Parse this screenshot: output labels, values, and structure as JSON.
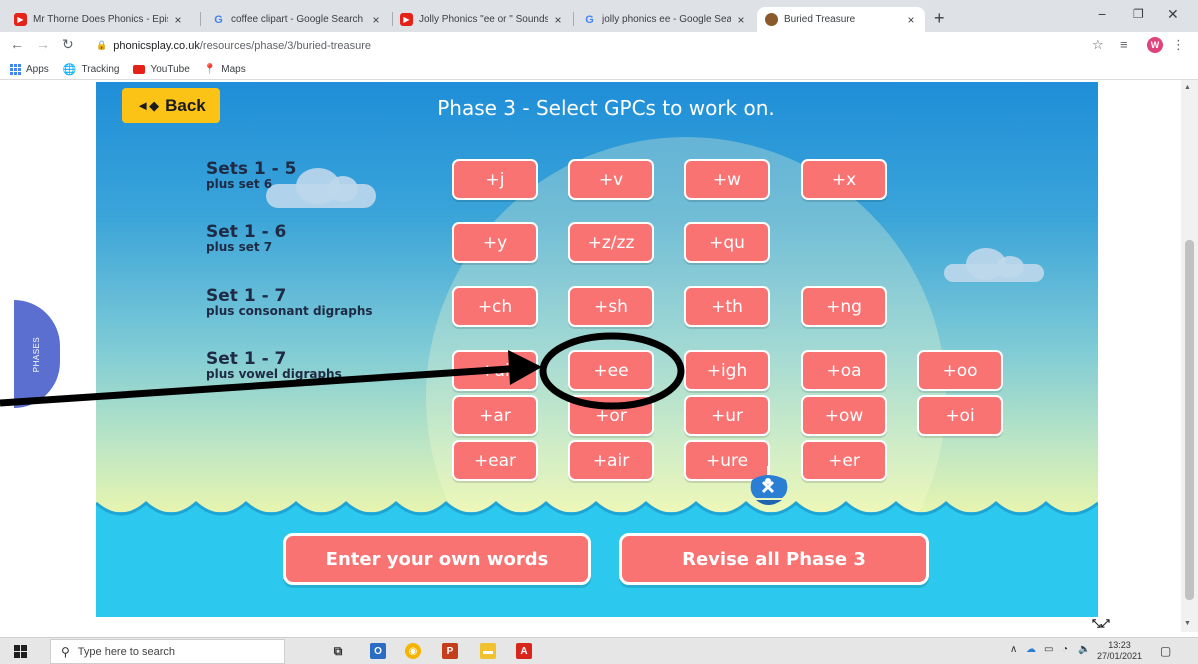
{
  "browser": {
    "tabs": [
      {
        "title": "Mr Thorne Does Phonics - Episo",
        "favicon": "youtube-icon",
        "active": false
      },
      {
        "title": "coffee clipart - Google Search",
        "favicon": "google-icon",
        "active": false
      },
      {
        "title": "Jolly Phonics \"ee or \" Sounds - Y",
        "favicon": "youtube-icon",
        "active": false
      },
      {
        "title": "jolly phonics ee - Google Search",
        "favicon": "google-icon",
        "active": false
      },
      {
        "title": "Buried Treasure",
        "favicon": "treasure-icon",
        "active": true
      }
    ],
    "url_host": "phonicsplay.co.uk",
    "url_path": "/resources/phase/3/buried-treasure",
    "profile_initial": "W",
    "bookmarks": [
      {
        "label": "Apps",
        "icon": "apps-grid-icon"
      },
      {
        "label": "Tracking",
        "icon": "globe-icon"
      },
      {
        "label": "YouTube",
        "icon": "youtube-icon"
      },
      {
        "label": "Maps",
        "icon": "maps-pin-icon"
      }
    ]
  },
  "game": {
    "back_label": "Back",
    "title": "Phase 3 - Select GPCs to work on.",
    "side_tab": "PHASES",
    "sets": [
      {
        "main": "Sets 1 - 5",
        "sub": "plus set 6"
      },
      {
        "main": "Set 1 - 6",
        "sub": "plus set 7"
      },
      {
        "main": "Set 1 - 7",
        "sub": "plus consonant digraphs"
      },
      {
        "main": "Set 1 - 7",
        "sub": "plus vowel digraphs"
      }
    ],
    "gpc_rows": [
      [
        "+j",
        "+v",
        "+w",
        "+x"
      ],
      [
        "+y",
        "+z/zz",
        "+qu"
      ],
      [
        "+ch",
        "+sh",
        "+th",
        "+ng"
      ],
      [
        "+ai",
        "+ee",
        "+igh",
        "+oa",
        "+oo"
      ],
      [
        "+ar",
        "+or",
        "+ur",
        "+ow",
        "+oi"
      ],
      [
        "+ear",
        "+air",
        "+ure",
        "+er"
      ]
    ],
    "selected_gpc": "+ee",
    "enter_words_label": "Enter your own words",
    "revise_label": "Revise all Phase 3"
  },
  "taskbar": {
    "search_placeholder": "Type here to search",
    "time": "13:23",
    "date": "27/01/2021"
  },
  "colors": {
    "button_pink": "#fa7373",
    "back_yellow": "#fbc316",
    "sea_blue": "#2cc8ee",
    "sky_top": "#1f8ed8",
    "phases_tab": "#5b6fd0"
  }
}
